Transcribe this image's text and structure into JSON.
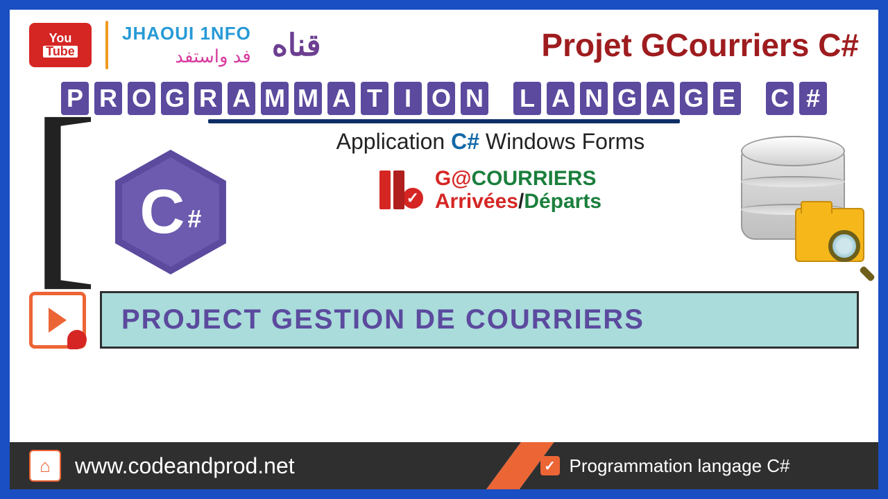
{
  "header": {
    "youtube_top": "You",
    "youtube_bottom": "Tube",
    "brand_name": "JHAOUI 1NFO",
    "brand_ar": "فد واستفد",
    "arabic_big": "قناه",
    "main_title": "Projet GCourriers C#"
  },
  "blocks": [
    "P",
    "R",
    "O",
    "G",
    "R",
    "A",
    "M",
    "M",
    "A",
    "T",
    "I",
    "O",
    "N",
    " ",
    "L",
    "A",
    "N",
    "G",
    "A",
    "G",
    "E",
    " ",
    "C",
    "#"
  ],
  "subtitle": {
    "app": "Application ",
    "csharp": "C#",
    "wf": "  Windows Forms"
  },
  "gc": {
    "line1_g": "G",
    "line1_at": "@",
    "line1_co": "COURRIERS",
    "line2_ar": "Arrivées",
    "line2_sl": "/",
    "line2_dp": "Départs"
  },
  "csharp_logo": {
    "c": "C",
    "hash": "#"
  },
  "banner": "PROJECT GESTION DE COURRIERS",
  "footer": {
    "url": "www.codeandprod.net",
    "tag": "Programmation langage C#",
    "check": "✓",
    "home": "⌂"
  },
  "icons": {
    "check": "✓"
  }
}
